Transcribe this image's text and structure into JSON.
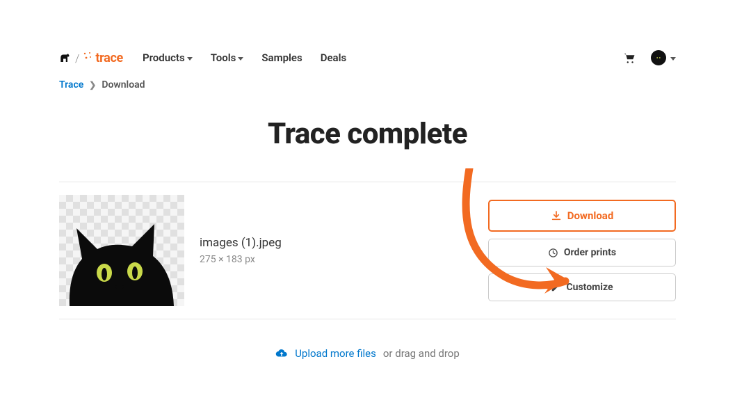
{
  "brand": {
    "name": "trace"
  },
  "nav": {
    "products": "Products",
    "tools": "Tools",
    "samples": "Samples",
    "deals": "Deals"
  },
  "breadcrumb": {
    "root": "Trace",
    "current": "Download"
  },
  "page": {
    "title": "Trace complete"
  },
  "result": {
    "filename": "images (1).jpeg",
    "dimensions": "275 × 183 px"
  },
  "actions": {
    "download": "Download",
    "order_prints": "Order prints",
    "customize": "Customize"
  },
  "upload": {
    "link": "Upload more files",
    "sub": "or drag and drop"
  }
}
